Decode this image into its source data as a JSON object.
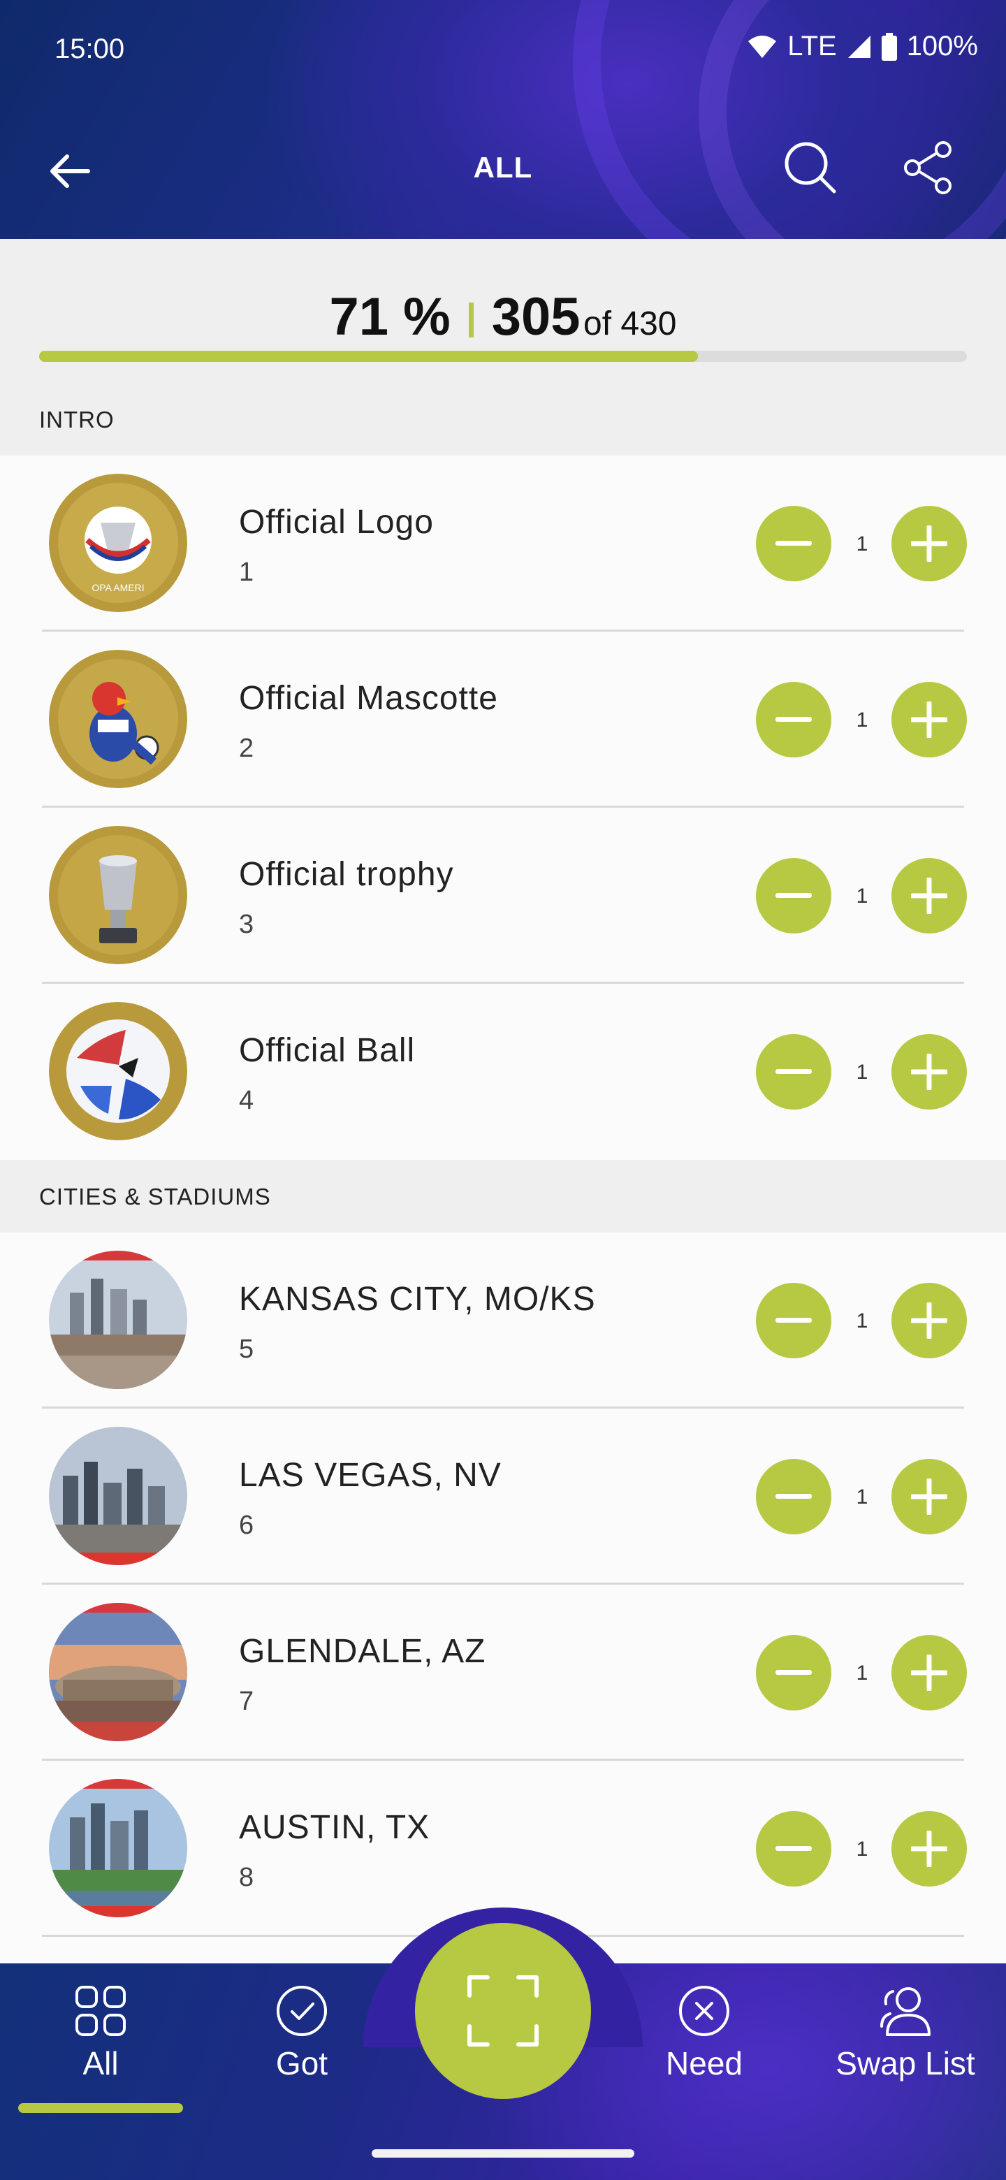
{
  "status_bar": {
    "time": "15:00",
    "network": "LTE",
    "battery": "100%"
  },
  "toolbar": {
    "title": "ALL"
  },
  "progress": {
    "percent_label": "71 %",
    "got": "305",
    "of_label": "of 430",
    "fraction": 0.71
  },
  "sections": [
    {
      "title": "INTRO",
      "items": [
        {
          "name": "Official Logo",
          "number": "1",
          "qty": "1"
        },
        {
          "name": "Official Mascotte",
          "number": "2",
          "qty": "1"
        },
        {
          "name": "Official trophy",
          "number": "3",
          "qty": "1"
        },
        {
          "name": "Official Ball",
          "number": "4",
          "qty": "1"
        }
      ]
    },
    {
      "title": "CITIES & STADIUMS",
      "items": [
        {
          "name": "KANSAS CITY, MO/KS",
          "number": "5",
          "qty": "1"
        },
        {
          "name": "LAS VEGAS, NV",
          "number": "6",
          "qty": "1"
        },
        {
          "name": "GLENDALE, AZ",
          "number": "7",
          "qty": "1"
        },
        {
          "name": "AUSTIN, TX",
          "number": "8",
          "qty": "1"
        }
      ]
    }
  ],
  "bottom_nav": {
    "items": [
      {
        "label": "All",
        "icon": "grid-icon",
        "active": true
      },
      {
        "label": "Got",
        "icon": "check-circle-icon"
      },
      {
        "label": "Need",
        "icon": "x-circle-icon"
      },
      {
        "label": "Swap List",
        "icon": "users-icon"
      }
    ],
    "center_icon": "scan-icon"
  },
  "colors": {
    "accent": "#b7c842",
    "header_blue": "#1c2d86",
    "header_purple": "#3a1fa8"
  }
}
